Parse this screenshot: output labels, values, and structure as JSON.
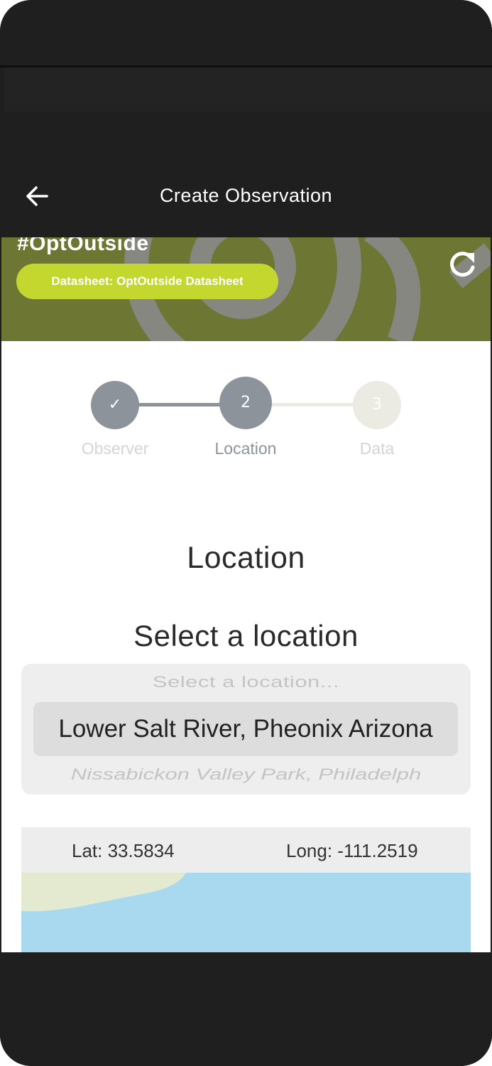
{
  "header": {
    "title": "Create Observation",
    "back_icon": "arrow-left-icon"
  },
  "banner": {
    "project_title": "#OptOutside",
    "datasheet_label": "Datasheet: OptOutside Datasheet",
    "refresh_icon": "refresh-icon",
    "background_color": "#6e7634",
    "pill_color": "#c3d72f"
  },
  "stepper": {
    "steps": [
      {
        "label": "Observer",
        "marker": "✓",
        "state": "completed"
      },
      {
        "label": "Location",
        "marker": "2",
        "state": "active"
      },
      {
        "label": "Data",
        "marker": "3",
        "state": "pending"
      }
    ],
    "active_color": "#8d939b",
    "pending_color": "#ebebe3"
  },
  "location": {
    "section_title": "Location",
    "prompt": "Select a location",
    "picker": {
      "previous_option": "Select a location...",
      "selected": "Lower Salt River, Pheonix Arizona",
      "next_option": "Nissabickon Valley Park, Philadelph"
    }
  },
  "map": {
    "lat_text": "Lat: 33.5834",
    "long_text": "Long: -111.2519",
    "water_color": "#a9d9ee",
    "land_color": "#e3ead0"
  }
}
